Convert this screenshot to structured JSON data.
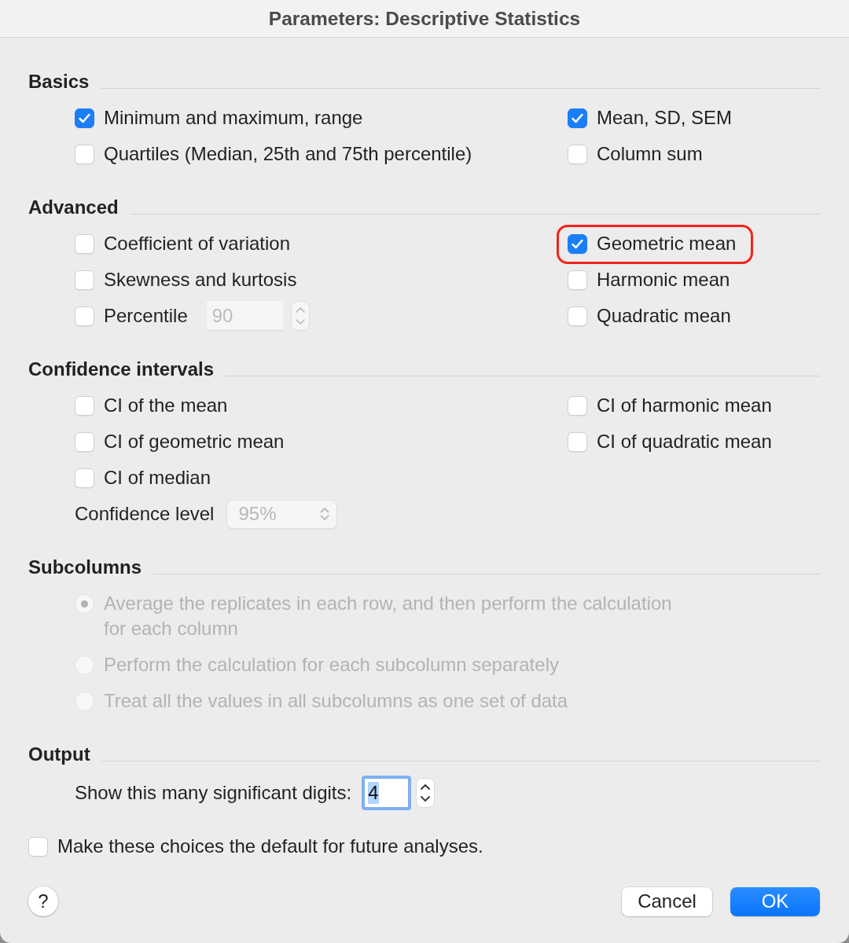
{
  "window": {
    "title": "Parameters: Descriptive Statistics"
  },
  "sections": [
    {
      "kind": "checks",
      "title": "Basics",
      "left": [
        {
          "kind": "checkbox",
          "label": "Minimum and maximum, range",
          "checked": true,
          "highlighted": false
        },
        {
          "kind": "checkbox",
          "label": "Quartiles (Median, 25th and 75th percentile)",
          "checked": false,
          "highlighted": false
        }
      ],
      "right": [
        {
          "kind": "checkbox",
          "label": "Mean, SD, SEM",
          "checked": true,
          "highlighted": false
        },
        {
          "kind": "checkbox",
          "label": "Column sum",
          "checked": false,
          "highlighted": false
        }
      ]
    },
    {
      "kind": "checks",
      "title": "Advanced",
      "left": [
        {
          "kind": "checkbox",
          "label": "Coefficient of variation",
          "checked": false,
          "highlighted": false
        },
        {
          "kind": "checkbox",
          "label": "Skewness and kurtosis",
          "checked": false,
          "highlighted": false
        },
        {
          "kind": "checkbox_number",
          "label": "Percentile",
          "checked": false,
          "highlighted": false,
          "field": {
            "value": "90",
            "disabled": true
          }
        }
      ],
      "right": [
        {
          "kind": "checkbox",
          "label": "Geometric mean",
          "checked": true,
          "highlighted": true
        },
        {
          "kind": "checkbox",
          "label": "Harmonic mean",
          "checked": false,
          "highlighted": false
        },
        {
          "kind": "checkbox",
          "label": "Quadratic mean",
          "checked": false,
          "highlighted": false
        }
      ]
    },
    {
      "kind": "checks",
      "title": "Confidence intervals",
      "left": [
        {
          "kind": "checkbox",
          "label": "CI of the mean",
          "checked": false,
          "highlighted": false
        },
        {
          "kind": "checkbox",
          "label": "CI of geometric mean",
          "checked": false,
          "highlighted": false
        },
        {
          "kind": "checkbox",
          "label": "CI of median",
          "checked": false,
          "highlighted": false
        },
        {
          "kind": "popup",
          "label": "Confidence level",
          "value": "95%",
          "disabled": true
        }
      ],
      "right": [
        {
          "kind": "checkbox",
          "label": "CI of harmonic mean",
          "checked": false,
          "highlighted": false
        },
        {
          "kind": "checkbox",
          "label": "CI of quadratic mean",
          "checked": false,
          "highlighted": false
        }
      ]
    },
    {
      "kind": "radios",
      "title": "Subcolumns",
      "disabled": true,
      "options": [
        {
          "label": "Average the replicates in each row, and then perform the calculation for each column",
          "selected": true
        },
        {
          "label": "Perform the calculation for each subcolumn separately",
          "selected": false
        },
        {
          "label": "Treat all the values in all subcolumns as one set of data",
          "selected": false
        }
      ]
    },
    {
      "kind": "output",
      "title": "Output",
      "label": "Show this many significant digits:",
      "value": "4",
      "focused": true
    }
  ],
  "default_choice": {
    "label": "Make these choices the default for future analyses.",
    "checked": false
  },
  "buttons": [
    {
      "kind": "help",
      "label": "?"
    },
    {
      "kind": "cancel",
      "label": "Cancel"
    },
    {
      "kind": "default",
      "label": "OK"
    }
  ]
}
